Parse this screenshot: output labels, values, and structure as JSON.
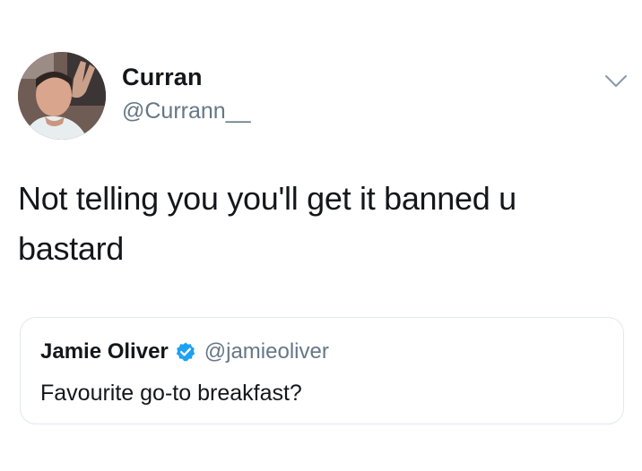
{
  "tweet": {
    "author": {
      "name": "Curran",
      "handle": "@Currann__",
      "avatar_icon": "profile-photo"
    },
    "text": "Not telling you you'll get it banned u bastard",
    "menu_icon": "chevron-down-icon",
    "quoted": {
      "name": "Jamie Oliver",
      "verified_icon": "verified-badge-icon",
      "verified_color": "#1da1f2",
      "handle": "@jamieoliver",
      "text": "Favourite go-to breakfast?"
    }
  },
  "colors": {
    "text_primary": "#14171a",
    "text_secondary": "#657786",
    "border": "#e1e8ed",
    "verified": "#1da1f2"
  }
}
